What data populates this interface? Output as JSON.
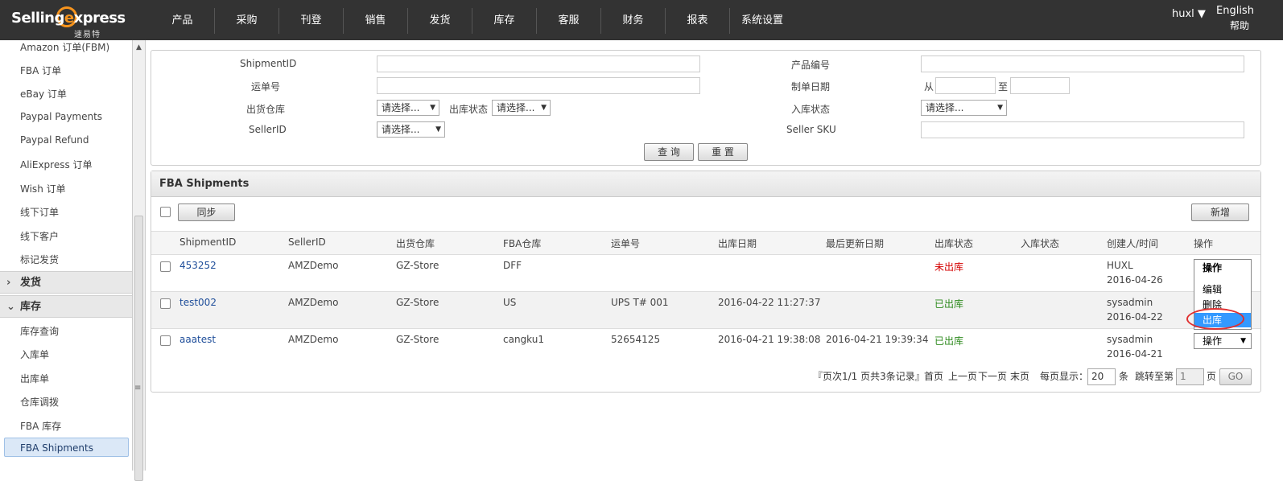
{
  "brand": {
    "logo_main_a": "Selling",
    "logo_main_b": "xpress",
    "logo_sub": "速易特"
  },
  "nav": [
    "产品",
    "采购",
    "刊登",
    "销售",
    "发货",
    "库存",
    "客服",
    "财务",
    "报表",
    "系统设置"
  ],
  "header": {
    "user": "huxl ▼",
    "lang": "English",
    "help": "帮助"
  },
  "sidebar": {
    "items_top": [
      "Amazon 订单(FBM)",
      "FBA 订单",
      "eBay 订单",
      "Paypal Payments",
      "Paypal Refund",
      "AliExpress 订单",
      "Wish 订单",
      "线下订单",
      "线下客户",
      "标记发货"
    ],
    "group_shipping": "发货",
    "group_inventory": "库存",
    "items_inventory": [
      "库存查询",
      "入库单",
      "出库单",
      "仓库调拨",
      "FBA 库存",
      "FBA Shipments"
    ]
  },
  "search": {
    "shipment_id_label": "ShipmentID",
    "waybill_label": "运单号",
    "warehouse_label": "出货仓库",
    "warehouse_value": "请选择...",
    "out_status_label": "出库状态",
    "out_status_value": "请选择...",
    "seller_id_label": "SellerID",
    "seller_id_value": "请选择...",
    "product_code_label": "产品编号",
    "date_label": "制单日期",
    "date_from": "从",
    "date_to": "至",
    "in_status_label": "入库状态",
    "in_status_value": "请选择...",
    "seller_sku_label": "Seller SKU",
    "query_button": "查 询",
    "reset_button": "重 置"
  },
  "grid": {
    "title": "FBA Shipments",
    "sync_button": "同步",
    "new_button": "新增",
    "columns": [
      "ShipmentID",
      "SellerID",
      "出货仓库",
      "FBA仓库",
      "运单号",
      "出库日期",
      "最后更新日期",
      "出库状态",
      "入库状态",
      "创建人/时间",
      "操作"
    ],
    "rows": [
      {
        "shipment_id": "453252",
        "seller_id": "AMZDemo",
        "warehouse": "GZ-Store",
        "fba_warehouse": "DFF",
        "waybill": "",
        "out_date": "",
        "updated": "",
        "out_status": "未出库",
        "in_status": "",
        "creator": "HUXL",
        "created": "2016-04-26"
      },
      {
        "shipment_id": "test002",
        "seller_id": "AMZDemo",
        "warehouse": "GZ-Store",
        "fba_warehouse": "US",
        "waybill": "UPS T# 001",
        "out_date": "2016-04-22 11:27:37",
        "updated": "",
        "out_status": "已出库",
        "in_status": "",
        "creator": "sysadmin",
        "created": "2016-04-22"
      },
      {
        "shipment_id": "aaatest",
        "seller_id": "AMZDemo",
        "warehouse": "GZ-Store",
        "fba_warehouse": "cangku1",
        "waybill": "52654125",
        "out_date": "2016-04-21 19:38:08",
        "updated": "2016-04-21 19:39:34",
        "out_status": "已出库",
        "in_status": "",
        "creator": "sysadmin",
        "created": "2016-04-21"
      }
    ],
    "action_menu": {
      "header": "操作",
      "options": [
        "编辑",
        "删除",
        "出库"
      ],
      "highlighted": "出库"
    },
    "action_select_value": "操作"
  },
  "pager": {
    "summary": "『页次1/1  页共3条记录』",
    "first": "首页",
    "prev": "上一页",
    "next": "下一页",
    "last": "末页",
    "per_page_label": "每页显示：",
    "per_page_value": "20",
    "per_page_unit": "条",
    "jump_label": "跳转至第",
    "jump_value": "1",
    "page_unit": "页",
    "go_button": "GO"
  },
  "colors": {
    "topbar": "#333333",
    "accent": "#f7941d",
    "link": "#1f4e9a",
    "not_shipped": "#d40000",
    "shipped": "#2e8b1e",
    "highlight": "#3399ff"
  }
}
